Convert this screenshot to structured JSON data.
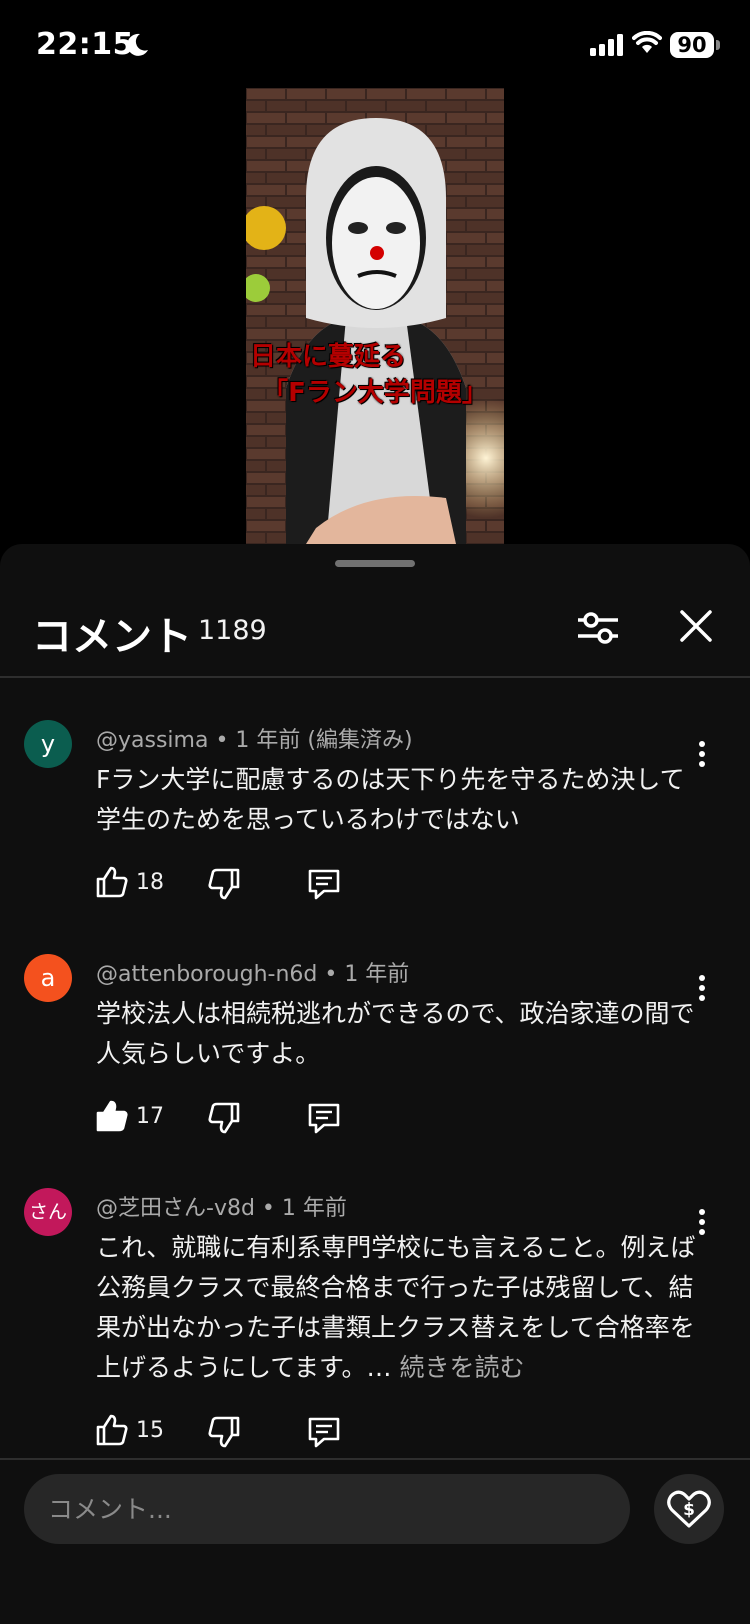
{
  "status_bar": {
    "time": "22:15",
    "battery": "90"
  },
  "video": {
    "overlay_line1": "日本に蔓延る",
    "overlay_line2": "「Fラン大学問題」"
  },
  "sheet": {
    "title": "コメント",
    "count": "1189"
  },
  "comments": [
    {
      "avatar": "y",
      "avatar_color": "#0b5d4f",
      "meta": "@yassima • 1 年前 (編集済み)",
      "text": "Fラン大学に配慮するのは天下り先を守るため決して学生のためを思っているわけではない",
      "likes": "18",
      "liked": false
    },
    {
      "avatar": "a",
      "avatar_color": "#f4511e",
      "meta": "@attenborough-n6d • 1 年前",
      "text": "学校法人は相続税逃れができるので、政治家達の間で人気らしいですよ。",
      "likes": "17",
      "liked": true
    },
    {
      "avatar": "さん",
      "avatar_color": "#c2185b",
      "meta": "@芝田さん-v8d • 1 年前",
      "text": "これ、就職に有利系専門学校にも言えること。例えば公務員クラスで最終合格まで行った子は残留して、結果が出なかった子は書類上クラス替えをして合格率を上げるようにしてます。…",
      "more": "続きを読む",
      "likes": "15",
      "liked": false
    }
  ],
  "input": {
    "placeholder": "コメント..."
  },
  "icons": {
    "filter": "sliders-icon",
    "close": "close-icon",
    "more": "kebab-icon",
    "like": "thumb-up-icon",
    "dislike": "thumb-down-icon",
    "reply": "reply-icon",
    "thanks": "super-thanks-heart-icon"
  }
}
